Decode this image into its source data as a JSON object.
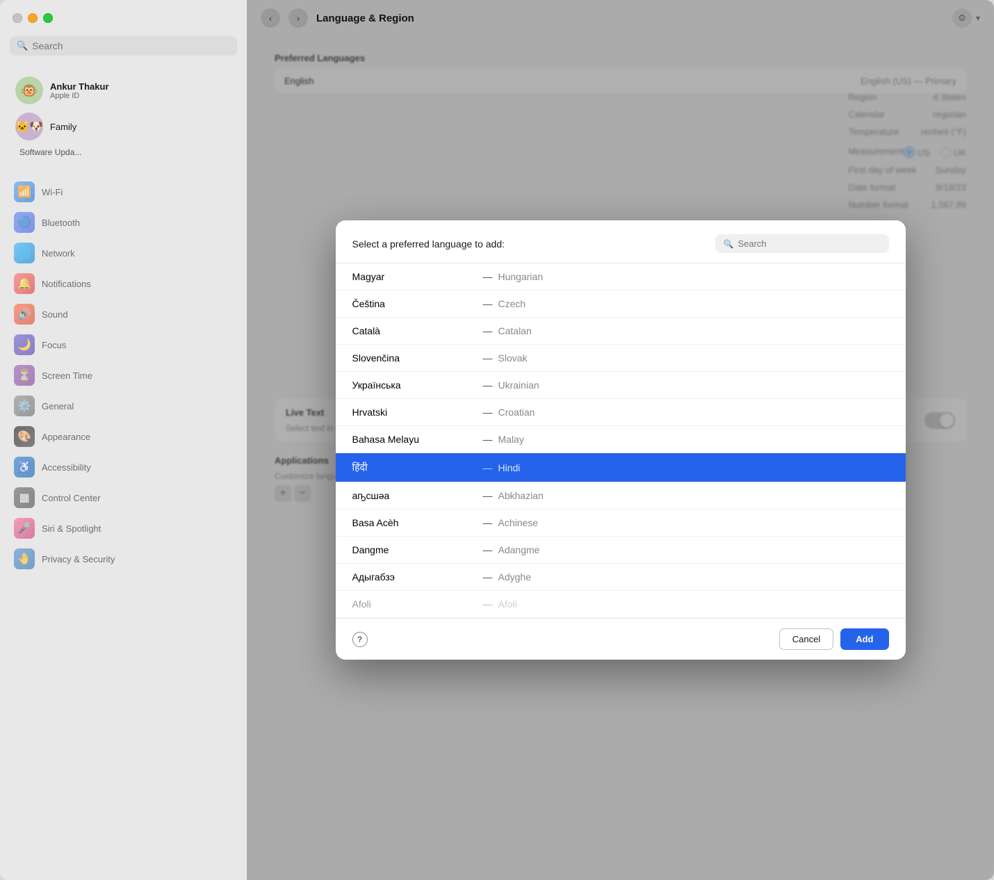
{
  "window": {
    "title": "Language & Region"
  },
  "sidebar": {
    "search_placeholder": "Search",
    "user": {
      "name": "Ankur Thakur",
      "apple_id": "Apple ID",
      "avatar": "🐵"
    },
    "family": {
      "label": "Family",
      "avatars": [
        "🐱",
        "🐶"
      ]
    },
    "software_update": "Software Upda...",
    "items": [
      {
        "id": "wifi",
        "label": "Wi-Fi",
        "icon": "wifi"
      },
      {
        "id": "bluetooth",
        "label": "Bluetooth",
        "icon": "bluetooth"
      },
      {
        "id": "network",
        "label": "Network",
        "icon": "network"
      },
      {
        "id": "notifications",
        "label": "Notifications",
        "icon": "notifications"
      },
      {
        "id": "sound",
        "label": "Sound",
        "icon": "sound"
      },
      {
        "id": "focus",
        "label": "Focus",
        "icon": "focus"
      },
      {
        "id": "screentime",
        "label": "Screen Time",
        "icon": "screentime"
      },
      {
        "id": "general",
        "label": "General",
        "icon": "general"
      },
      {
        "id": "appearance",
        "label": "Appearance",
        "icon": "appearance"
      },
      {
        "id": "accessibility",
        "label": "Accessibility",
        "icon": "accessibility"
      },
      {
        "id": "controlcenter",
        "label": "Control Center",
        "icon": "controlcenter"
      },
      {
        "id": "siri",
        "label": "Siri & Spotlight",
        "icon": "siri"
      },
      {
        "id": "privacy",
        "label": "Privacy & Security",
        "icon": "privacy"
      }
    ]
  },
  "content": {
    "nav_back": "‹",
    "nav_forward": "›",
    "title": "Language & Region",
    "preferred_languages_label": "Preferred Languages",
    "english_language": "English",
    "english_primary": "English (US) — Primary",
    "right_panel": {
      "region_label": "Region",
      "region_value": "d States",
      "calendar_label": "Calendar",
      "calendar_value": "regorian",
      "temperature_label": "Temperature",
      "temperature_value": "renheit (°F)",
      "measurement_label": "Measurement",
      "measurement_us": "US",
      "measurement_uk": "UK",
      "first_day_label": "First day of week",
      "first_day_value": "Sunday",
      "date_format_label": "Date format",
      "date_format_value": "8/19/23",
      "number_format_label": "Number format",
      "number_format_value": "1,567.89"
    },
    "live_text_title": "Live Text",
    "live_text_subtitle": "Select text in images to copy or take action.",
    "apps_title": "Applications",
    "apps_subtitle": "Customize language settings for the following applications:"
  },
  "modal": {
    "title": "Select a preferred language to add:",
    "search_placeholder": "Search",
    "help_label": "?",
    "cancel_label": "Cancel",
    "add_label": "Add",
    "languages": [
      {
        "native": "Magyar",
        "english": "Hungarian",
        "selected": false
      },
      {
        "native": "Čeština",
        "english": "Czech",
        "selected": false
      },
      {
        "native": "Català",
        "english": "Catalan",
        "selected": false
      },
      {
        "native": "Slovenčina",
        "english": "Slovak",
        "selected": false
      },
      {
        "native": "Українська",
        "english": "Ukrainian",
        "selected": false
      },
      {
        "native": "Hrvatski",
        "english": "Croatian",
        "selected": false
      },
      {
        "native": "Bahasa Melayu",
        "english": "Malay",
        "selected": false
      },
      {
        "native": "हिंदी",
        "english": "Hindi",
        "selected": true
      },
      {
        "native": "аҧсшәа",
        "english": "Abkhazian",
        "selected": false
      },
      {
        "native": "Basa Acèh",
        "english": "Achinese",
        "selected": false
      },
      {
        "native": "Dangme",
        "english": "Adangme",
        "selected": false
      },
      {
        "native": "Адыгабзэ",
        "english": "Adyghe",
        "selected": false
      },
      {
        "native": "Afoli",
        "english": "Afoli",
        "selected": false
      }
    ]
  }
}
